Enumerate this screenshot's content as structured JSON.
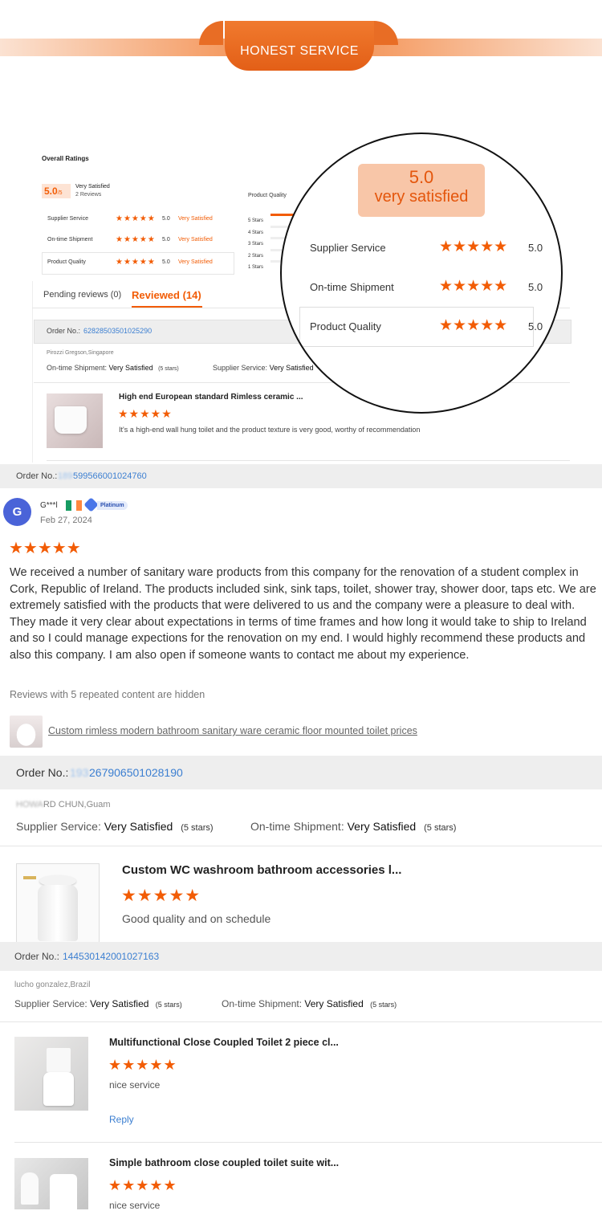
{
  "banner": {
    "title": "HONEST  SERVICE"
  },
  "summary": {
    "overall_label": "Overall Ratings",
    "score": "5.0",
    "score_suffix": "/5",
    "satisfaction": "Very Satisfied",
    "reviews_count": "2 Reviews",
    "rows": [
      {
        "name": "Supplier Service",
        "stars": "★★★★★",
        "score": "5.0",
        "status": "Very Satisfied"
      },
      {
        "name": "On-time Shipment",
        "stars": "★★★★★",
        "score": "5.0",
        "status": "Very Satisfied"
      },
      {
        "name": "Product Quality",
        "stars": "★★★★★",
        "score": "5.0",
        "status": "Very Satisfied"
      }
    ],
    "product_quality_title": "Product Quality",
    "distribution": [
      {
        "label": "5 Stars",
        "fraction": 1.0
      },
      {
        "label": "4 Stars",
        "fraction": 0
      },
      {
        "label": "3 Stars",
        "fraction": 0
      },
      {
        "label": "2 Stars",
        "fraction": 0
      },
      {
        "label": "1 Stars",
        "fraction": 0
      }
    ]
  },
  "zoom": {
    "score": "5.0",
    "label": "very satisfied",
    "rows": [
      {
        "name": "Supplier Service",
        "stars": "★★★★★",
        "score": "5.0"
      },
      {
        "name": "On-time Shipment",
        "stars": "★★★★★",
        "score": "5.0"
      },
      {
        "name": "Product Quality",
        "stars": "★★★★★",
        "score": "5.0"
      }
    ]
  },
  "tabs": {
    "pending": "Pending reviews (0)",
    "reviewed": "Reviewed (14)"
  },
  "review1": {
    "order_label": "Order No.:",
    "order_no": "62828503501025290",
    "buyer": "Pirozzi Gregson,Singapore",
    "shipment_label": "On-time Shipment:",
    "shipment_value": "Very Satisfied",
    "shipment_stars": "(5 stars)",
    "supplier_label": "Supplier Service:",
    "supplier_value": "Very Satisfied",
    "product_title": "High end European standard Rimless ceramic ...",
    "stars": "★★★★★",
    "comment": "It's a high-end wall hung toilet and the product texture is very good, worthy of recommendation"
  },
  "review2": {
    "order_label": "Order No.:",
    "order_prefix": "189",
    "order_no": "599566001024760",
    "avatar_letter": "G",
    "name": "G***l",
    "badge": "Platinum",
    "date": "Feb 27, 2024",
    "stars": "★★★★★",
    "body": "We received a number of sanitary ware products from this company for the renovation of a student complex in Cork, Republic of Ireland. The products included sink, sink taps, toilet, shower tray, shower door, taps etc. We are extremely satisfied with the products that were delivered to us and the company were a pleasure to deal with. They made it very clear about expectations in terms of time frames and how long it would take to ship to Ireland and so I could manage expections for the renovation on my end. I would highly recommend these products and also this company. I am also open if someone wants to contact me about my experience.",
    "hidden_note": "Reviews with 5 repeated content are hidden",
    "product_link": "Custom rimless modern bathroom sanitary ware ceramic floor mounted toilet prices"
  },
  "review3": {
    "order_label": "Order No.:",
    "order_prefix": "193",
    "order_no": "267906501028190",
    "buyer_prefix": "HOWA",
    "buyer": "RD CHUN,Guam",
    "supplier_label": "Supplier Service:",
    "supplier_value": "Very Satisfied",
    "supplier_stars": "(5 stars)",
    "shipment_label": "On-time Shipment:",
    "shipment_value": "Very Satisfied",
    "shipment_stars": "(5 stars)",
    "product_title": "Custom WC washroom bathroom accessories l...",
    "stars": "★★★★★",
    "comment": "Good quality and on schedule"
  },
  "review4": {
    "order_label": "Order No.:",
    "order_no": "144530142001027163",
    "buyer": "lucho gonzalez,Brazil",
    "supplier_label": "Supplier Service:",
    "supplier_value": "Very Satisfied",
    "supplier_stars": "(5 stars)",
    "shipment_label": "On-time Shipment:",
    "shipment_value": "Very Satisfied",
    "shipment_stars": "(5 stars)",
    "product_title": "Multifunctional Close Coupled Toilet 2 piece cl...",
    "stars": "★★★★★",
    "comment": "nice service",
    "reply": "Reply"
  },
  "review5": {
    "product_title": "Simple bathroom close coupled toilet suite wit...",
    "stars": "★★★★★",
    "comment": "nice service"
  }
}
